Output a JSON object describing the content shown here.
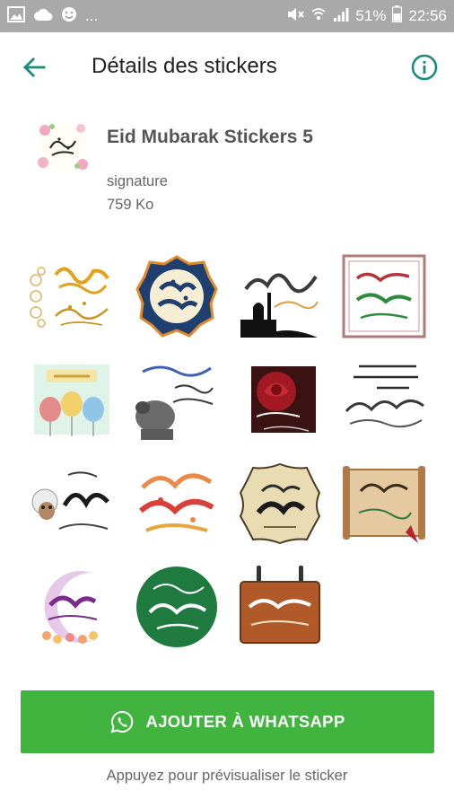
{
  "status_bar": {
    "ellipsis": "...",
    "battery_percent": "51%",
    "time": "22:56"
  },
  "app_bar": {
    "title": "Détails des stickers",
    "accent_color": "#1a8a7a"
  },
  "pack": {
    "name": "Eid Mubarak Stickers 5",
    "author": "signature",
    "size": "759 Ko"
  },
  "stickers": [
    {
      "name": "sticker-eid-adha-gold-floral"
    },
    {
      "name": "sticker-eid-said-octagon"
    },
    {
      "name": "sticker-adha-mubarak-mosque"
    },
    {
      "name": "sticker-eid-adha-framed"
    },
    {
      "name": "sticker-happy-balloons"
    },
    {
      "name": "sticker-adha-mubarak-sheep"
    },
    {
      "name": "sticker-red-rose"
    },
    {
      "name": "sticker-eid-text-wishes"
    },
    {
      "name": "sticker-eid-adha-cartoon-sheep"
    },
    {
      "name": "sticker-kol-am-colorful"
    },
    {
      "name": "sticker-adha-badge-beige"
    },
    {
      "name": "sticker-adha-mubarak-scroll"
    },
    {
      "name": "sticker-adha-crescent-flowers"
    },
    {
      "name": "sticker-adha-mubarak-green-circle"
    },
    {
      "name": "sticker-eidkom-mubarak-wood-sign"
    }
  ],
  "add_button": {
    "label": "AJOUTER À WHATSAPP",
    "color": "#40b43e"
  },
  "hint": "Appuyez pour prévisualiser le sticker"
}
